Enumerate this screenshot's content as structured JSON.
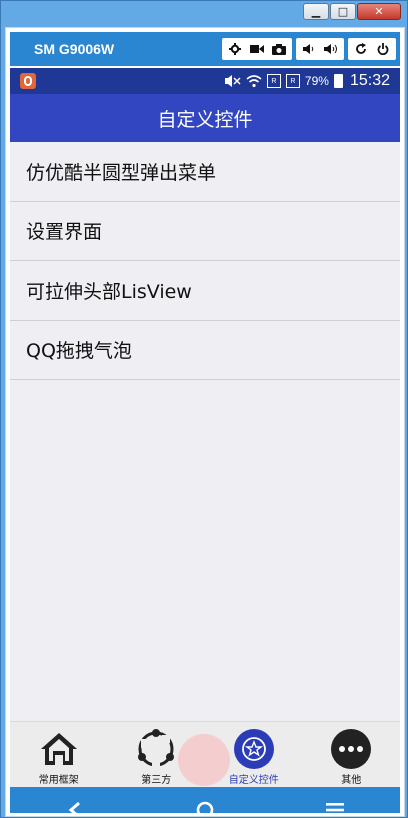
{
  "window": {
    "device_name": "SM G9006W",
    "controls": {
      "minimize": "▁",
      "maximize": "□",
      "close": "✕"
    }
  },
  "device_toolbar": {
    "buttons": [
      "gear-icon",
      "video-icon",
      "camera-icon",
      "volume-down-icon",
      "volume-up-icon",
      "rotate-icon",
      "power-icon"
    ]
  },
  "status_bar": {
    "battery_percent": "79%",
    "time": "15:32",
    "sim_label": "R"
  },
  "app_bar": {
    "title": "自定义控件"
  },
  "list": {
    "items": [
      {
        "label": "仿优酷半圆型弹出菜单"
      },
      {
        "label": "设置界面"
      },
      {
        "label": "可拉伸头部LisView"
      },
      {
        "label": "QQ拖拽气泡"
      }
    ]
  },
  "bottom_nav": {
    "tabs": [
      {
        "label": "常用框架",
        "icon": "home-icon",
        "active": false
      },
      {
        "label": "第三方",
        "icon": "sync-circle-icon",
        "active": false
      },
      {
        "label": "自定义控件",
        "icon": "star-badge-icon",
        "active": true
      },
      {
        "label": "其他",
        "icon": "more-dots-icon",
        "active": false
      }
    ]
  },
  "soft_keys": [
    "back-icon",
    "home-circle-icon",
    "menu-icon"
  ],
  "colors": {
    "app_bar": "#3346c1",
    "status_bar": "#1f3795",
    "device_bar": "#2a86d1",
    "active_tab": "#2b3db6",
    "list_background": "#efeef3"
  }
}
